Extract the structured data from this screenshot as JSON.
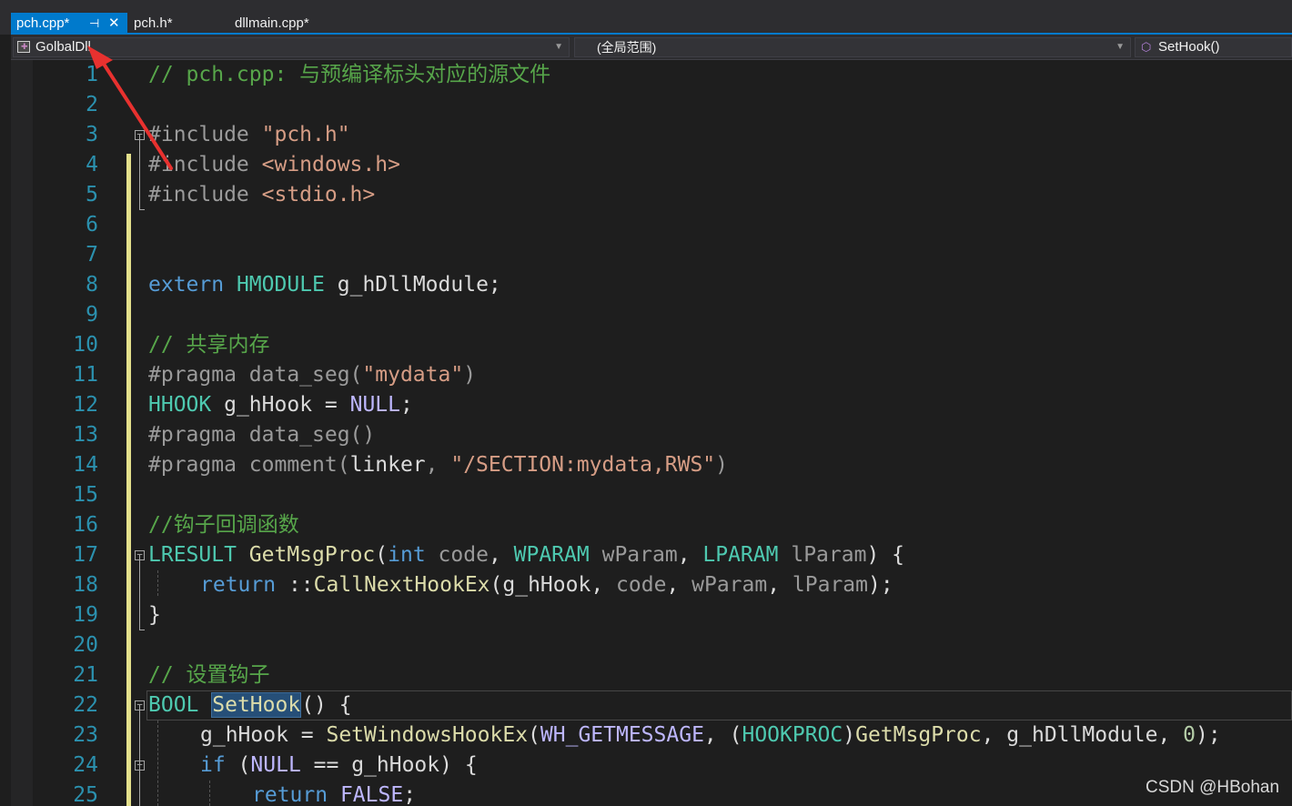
{
  "tabs": [
    {
      "label": "pch.cpp*",
      "active": true
    },
    {
      "label": "pch.h*",
      "active": false
    },
    {
      "label": "dllmain.cpp*",
      "active": false
    }
  ],
  "nav": {
    "project": "GolbalDll",
    "scope": "(全局范围)",
    "member": "SetHook()"
  },
  "editor": {
    "line_numbers": [
      "1",
      "2",
      "3",
      "4",
      "5",
      "6",
      "7",
      "8",
      "9",
      "10",
      "11",
      "12",
      "13",
      "14",
      "15",
      "16",
      "17",
      "18",
      "19",
      "20",
      "21",
      "22",
      "23",
      "24",
      "25"
    ],
    "current_line": 22,
    "highlight_word": "SetHook"
  },
  "code": {
    "l1": {
      "comment": "// pch.cpp: 与预编译标头对应的源文件"
    },
    "l3": {
      "pre": "#include ",
      "str": "\"pch.h\""
    },
    "l4": {
      "pre": "#include ",
      "str": "<windows.h>"
    },
    "l5": {
      "pre": "#include ",
      "str": "<stdio.h>"
    },
    "l8": {
      "kw": "extern",
      "type": "HMODULE",
      "ident": "g_hDllModule",
      "end": ";"
    },
    "l10": {
      "comment": "// 共享内存"
    },
    "l11": {
      "pre": "#pragma data_seg(",
      "str": "\"mydata\"",
      "end": ")"
    },
    "l12": {
      "type": "HHOOK",
      "ident": "g_hHook",
      "op": " = ",
      "macro": "NULL",
      "end": ";"
    },
    "l13": {
      "pre": "#pragma data_seg()"
    },
    "l14": {
      "pre": "#pragma comment(",
      "plain": "linker",
      "sep": ", ",
      "str": "\"/SECTION:mydata,RWS\"",
      "end": ")"
    },
    "l16": {
      "comment": "//钩子回调函数"
    },
    "l17": {
      "type": "LRESULT",
      "fn": "GetMsgProc",
      "open": "(",
      "kw": "int",
      "p1": "code",
      "sep1": ", ",
      "t2": "WPARAM",
      "p2": "wParam",
      "sep2": ", ",
      "t3": "LPARAM",
      "p3": "lParam",
      "close": ") {"
    },
    "l18": {
      "kw": "return",
      "scope": "::",
      "fn": "CallNextHookEx",
      "open": "(",
      "a1": "g_hHook",
      "sep1": ", ",
      "a2": "code",
      "sep2": ", ",
      "a3": "wParam",
      "sep3": ", ",
      "a4": "lParam",
      "close": ");"
    },
    "l19": {
      "brace": "}"
    },
    "l21": {
      "comment": "// 设置钩子"
    },
    "l22": {
      "type": "BOOL",
      "fn": "SetHook",
      "rest": "() {"
    },
    "l23": {
      "ident": "g_hHook",
      "op": " = ",
      "fn": "SetWindowsHookEx",
      "open": "(",
      "macro": "WH_GETMESSAGE",
      "sep1": ", (",
      "type": "HOOKPROC",
      "cl": ")",
      "fn2": "GetMsgProc",
      "sep2": ", ",
      "ident2": "g_hDllModule",
      "sep3": ", ",
      "num": "0",
      "close": ");"
    },
    "l24": {
      "kw": "if",
      "open": " (",
      "macro": "NULL",
      "op": " == ",
      "ident": "g_hHook",
      "close": ") {"
    },
    "l25": {
      "kw": "return",
      "macro": "FALSE",
      "end": ";"
    }
  },
  "watermark": "CSDN @HBohan",
  "colors": {
    "accent": "#007acc",
    "comment": "#57a64a",
    "keyword": "#569cd6",
    "type": "#4ec9b0",
    "string": "#d69d85",
    "function": "#dcdcaa",
    "line_number": "#2b91af",
    "change_bar": "#e4e08c",
    "annotation_arrow": "#e8312f"
  }
}
